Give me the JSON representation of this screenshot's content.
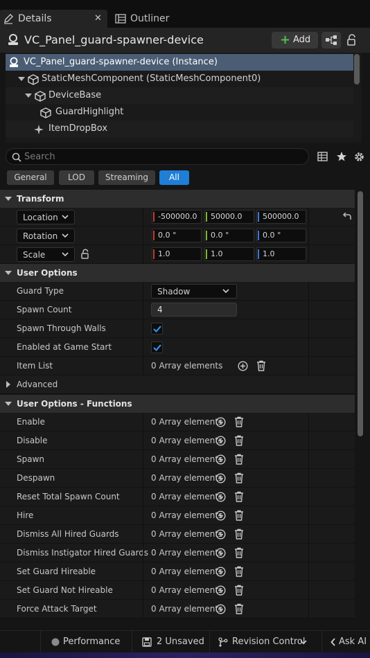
{
  "tabs": {
    "details": "Details",
    "outliner": "Outliner",
    "close_glyph": "✕"
  },
  "header": {
    "title": "VC_Panel_guard-spawner-device",
    "add_label": "Add"
  },
  "tree": {
    "items": [
      {
        "label": "VC_Panel_guard-spawner-device (Instance)"
      },
      {
        "label": "StaticMeshComponent (StaticMeshComponent0)"
      },
      {
        "label": "DeviceBase"
      },
      {
        "label": "GuardHighlight"
      },
      {
        "label": "ItemDropBox"
      }
    ]
  },
  "search": {
    "placeholder": "Search"
  },
  "filters": [
    "General",
    "LOD",
    "Streaming",
    "All"
  ],
  "active_filter": "All",
  "transform": {
    "section": "Transform",
    "location": {
      "label": "Location",
      "x": "-500000.0",
      "y": "50000.0",
      "z": "500000.0"
    },
    "rotation": {
      "label": "Rotation",
      "x": "0.0 °",
      "y": "0.0 °",
      "z": "0.0 °"
    },
    "scale": {
      "label": "Scale",
      "x": "1.0",
      "y": "1.0",
      "z": "1.0"
    }
  },
  "user_options": {
    "section": "User Options",
    "guard_type": {
      "label": "Guard Type",
      "value": "Shadow"
    },
    "spawn_count": {
      "label": "Spawn Count",
      "value": "4"
    },
    "spawn_through_walls": {
      "label": "Spawn Through Walls",
      "checked": true
    },
    "enabled_at_game_start": {
      "label": "Enabled at Game Start",
      "checked": true
    },
    "item_list": {
      "label": "Item List",
      "value": "0 Array elements"
    }
  },
  "advanced": {
    "section": "Advanced"
  },
  "functions": {
    "section": "User Options - Functions",
    "rows": [
      {
        "label": "Enable",
        "value": "0 Array elements"
      },
      {
        "label": "Disable",
        "value": "0 Array elements"
      },
      {
        "label": "Spawn",
        "value": "0 Array elements"
      },
      {
        "label": "Despawn",
        "value": "0 Array elements"
      },
      {
        "label": "Reset Total Spawn Count",
        "value": "0 Array elements"
      },
      {
        "label": "Hire",
        "value": "0 Array elements"
      },
      {
        "label": "Dismiss All Hired Guards",
        "value": "0 Array elements"
      },
      {
        "label": "Dismiss Instigator Hired Guards",
        "value": "0 Array elements"
      },
      {
        "label": "Set Guard Hireable",
        "value": "0 Array elements"
      },
      {
        "label": "Set Guard Not Hireable",
        "value": "0 Array elements"
      },
      {
        "label": "Force Attack Target",
        "value": "0 Array elements"
      }
    ]
  },
  "statusbar": {
    "performance": "Performance",
    "unsaved": "2 Unsaved",
    "revision": "Revision Control",
    "ask_ai": "Ask AI"
  },
  "colors": {
    "accent": "#1f7ed6",
    "axis_x": "#c43a2e",
    "axis_y": "#7cb82f",
    "axis_z": "#3a7bd5",
    "add_green": "#4fc24a"
  }
}
